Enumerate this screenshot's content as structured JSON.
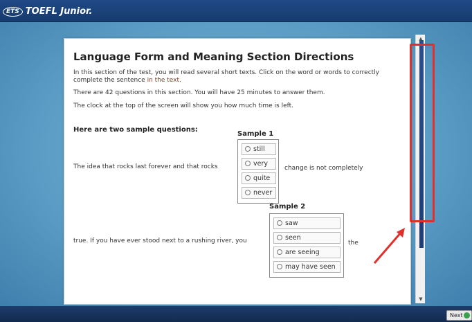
{
  "header": {
    "logo_text": "ETS",
    "app_title": "TOEFL Junior."
  },
  "content": {
    "title": "Language Form and Meaning Section Directions",
    "para1_main": "In this section of the test, you will read several short texts. Click on the word or words to correctly complete the sentence ",
    "para1_highlight": "in the text.",
    "para2": "There are 42 questions in this section. You will have 25 minutes to answer them.",
    "para3": "The clock at the top of the screen will show you how much time is left.",
    "samples_heading": "Here are two sample questions:"
  },
  "sample1": {
    "title": "Sample 1",
    "sentence_before": "The idea that rocks last forever and that rocks",
    "sentence_after": "change is not completely",
    "options": [
      "still",
      "very",
      "quite",
      "never"
    ]
  },
  "sample2": {
    "title": "Sample 2",
    "sentence_before": "true. If you have ever stood next to a rushing river, you",
    "sentence_after": "the",
    "options": [
      "saw",
      "seen",
      "are seeing",
      "may have seen"
    ]
  },
  "footer": {
    "next_label": "Next"
  },
  "colors": {
    "topbar": "#1f4a86",
    "stage": "#5a9cc4",
    "annotation": "#e0302c",
    "scroll_thumb": "#2b4d8c",
    "next_icon": "#3aa24a"
  }
}
